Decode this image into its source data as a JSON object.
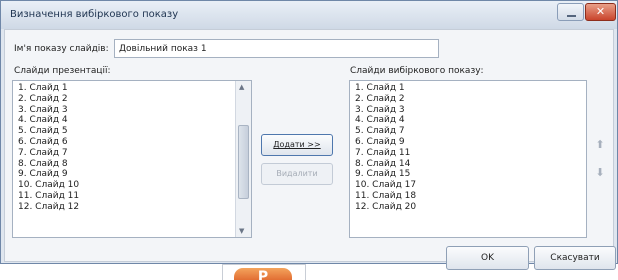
{
  "window": {
    "title": "Визначення вибіркового показу",
    "close_glyph": "✕"
  },
  "show_name": {
    "label": "Ім'я показу слайдів:",
    "value": "Довільний показ 1"
  },
  "presentation_slides": {
    "label": "Слайди презентації:",
    "items": [
      "1. Слайд 1",
      "2. Слайд 2",
      "3. Слайд 3",
      "4. Слайд 4",
      "5. Слайд 5",
      "6. Слайд 6",
      "7. Слайд 7",
      "8. Слайд 8",
      "9. Слайд 9",
      "10. Слайд 10",
      "11. Слайд 11",
      "12. Слайд 12"
    ]
  },
  "custom_show_slides": {
    "label": "Слайди вибіркового показу:",
    "items": [
      "1. Слайд 1",
      "2. Слайд 2",
      "3. Слайд 3",
      "4. Слайд 4",
      "5. Слайд 7",
      "6. Слайд 9",
      "7. Слайд 11",
      "8. Слайд 14",
      "9. Слайд 15",
      "10. Слайд 17",
      "11. Слайд 18",
      "12. Слайд 20"
    ]
  },
  "buttons": {
    "add": "Додати >>",
    "remove": "Видалити",
    "ok": "OK",
    "cancel": "Скасувати"
  },
  "icons": {
    "move_up": "arrow-up-icon",
    "move_down": "arrow-down-icon",
    "app_logo": "powerpoint-logo-icon"
  },
  "colors": {
    "close_button": "#c9442c",
    "add_button_border": "#4e77ad",
    "app_logo": "#d9541f"
  }
}
